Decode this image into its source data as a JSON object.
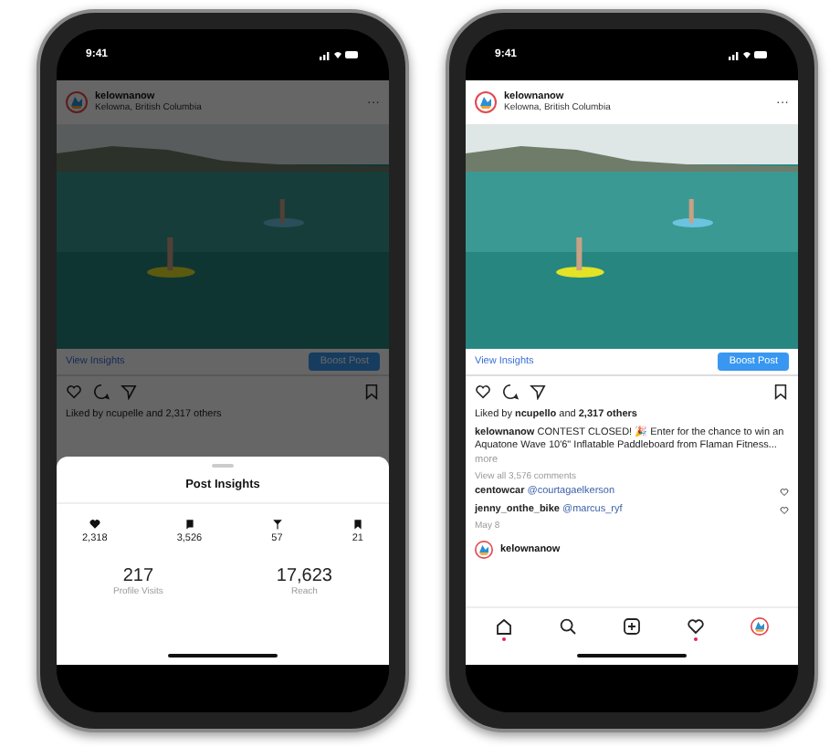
{
  "phones": [
    {
      "status_bar": {
        "time": "9:41"
      },
      "dimmed": true,
      "post": {
        "username": "kelownanow",
        "location": "Kelowna, British Columbia",
        "more": "···",
        "insights_link": "View Insights",
        "boost_button": "Boost Post",
        "liked_by": "Liked by ncupelle and 2,317 others"
      },
      "insights_sheet": {
        "title": "Post Insights",
        "stats": [
          {
            "kind": "likes",
            "value": "2,318"
          },
          {
            "kind": "comments",
            "value": "3,526"
          },
          {
            "kind": "shares",
            "value": "57"
          },
          {
            "kind": "saves",
            "value": "21"
          }
        ],
        "summary": [
          {
            "value": "217",
            "label": "Profile Visits"
          },
          {
            "value": "17,623",
            "label": "Reach"
          }
        ]
      }
    },
    {
      "status_bar": {
        "time": "9:41"
      },
      "dimmed": false,
      "post": {
        "username": "kelownanow",
        "location": "Kelowna, British Columbia",
        "more": "···",
        "insights_link": "View Insights",
        "boost_button": "Boost Post",
        "liked_by": "Liked by **ncupello** and **2,317 others**",
        "caption": "**kelownanow** CONTEST CLOSED! 🎉 Enter for the chance to win an Aquatone Wave 10'6\" Inflatable Paddleboard from Flaman Fitness...",
        "caption_more": "more",
        "view_comments": "View all 3,576 comments",
        "comments": [
          {
            "user": "centowcar",
            "text": "@courtagaelkerson"
          },
          {
            "user": "jenny_onthe_bike",
            "text": "@marcus_ryf"
          }
        ],
        "date": "May 8",
        "next_username": "kelownanow"
      },
      "tab_bar": [
        {
          "kind": "home",
          "dot": true
        },
        {
          "kind": "search",
          "dot": false
        },
        {
          "kind": "add",
          "dot": false
        },
        {
          "kind": "activity",
          "dot": true
        },
        {
          "kind": "profile",
          "dot": false
        }
      ]
    }
  ]
}
